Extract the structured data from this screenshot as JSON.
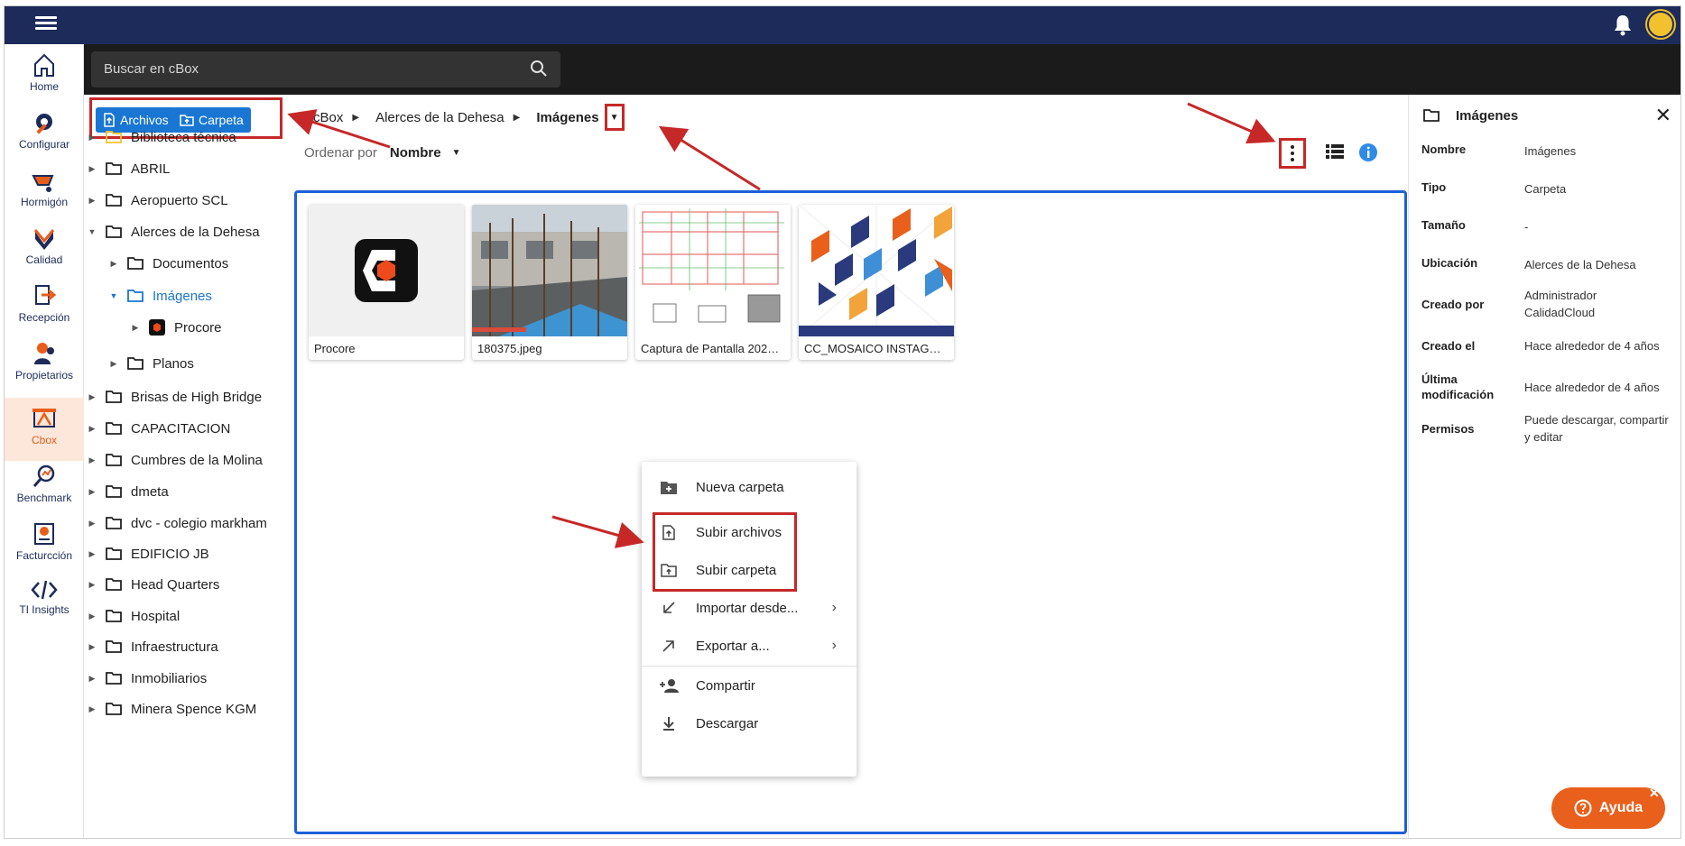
{
  "search": {
    "placeholder": "Buscar en cBox"
  },
  "rail": [
    {
      "label": "Home"
    },
    {
      "label": "Configurar"
    },
    {
      "label": "Hormigón"
    },
    {
      "label": "Calidad"
    },
    {
      "label": "Recepción"
    },
    {
      "label": "Propietarios"
    },
    {
      "label": "Cbox"
    },
    {
      "label": "Benchmark"
    },
    {
      "label": "Facturcción"
    },
    {
      "label": "TI Insights"
    }
  ],
  "upload": {
    "files_label": "Archivos",
    "folder_label": "Carpeta"
  },
  "tree": [
    {
      "label": "Biblioteca técnica"
    },
    {
      "label": "ABRIL"
    },
    {
      "label": "Aeropuerto SCL"
    },
    {
      "label": "Alerces de la Dehesa"
    },
    {
      "label": "Documentos"
    },
    {
      "label": "Imágenes"
    },
    {
      "label": "Procore"
    },
    {
      "label": "Planos"
    },
    {
      "label": "Brisas de High Bridge"
    },
    {
      "label": "CAPACITACION"
    },
    {
      "label": "Cumbres de la Molina"
    },
    {
      "label": "dmeta"
    },
    {
      "label": "dvc - colegio markham"
    },
    {
      "label": "EDIFICIO JB"
    },
    {
      "label": "Head Quarters"
    },
    {
      "label": "Hospital"
    },
    {
      "label": "Infraestructura"
    },
    {
      "label": "Inmobiliarios"
    },
    {
      "label": "Minera Spence KGM"
    }
  ],
  "breadcrumb": {
    "root": "cBox",
    "parent": "Alerces de la Dehesa",
    "current": "Imágenes"
  },
  "sort": {
    "label": "Ordenar por",
    "value": "Nombre"
  },
  "files": [
    {
      "name": "Procore"
    },
    {
      "name": "180375.jpeg"
    },
    {
      "name": "Captura de Pantalla 2022-0..."
    },
    {
      "name": "CC_MOSAICO INSTAGRAM L..."
    }
  ],
  "context_menu": {
    "new_folder": "Nueva carpeta",
    "upload_files": "Subir archivos",
    "upload_folder": "Subir carpeta",
    "import_from": "Importar desde...",
    "export_to": "Exportar a...",
    "share": "Compartir",
    "download": "Descargar"
  },
  "detail": {
    "title": "Imágenes",
    "rows": [
      {
        "key": "Nombre",
        "value": "Imágenes"
      },
      {
        "key": "Tipo",
        "value": "Carpeta"
      },
      {
        "key": "Tamaño",
        "value": "-"
      },
      {
        "key": "Ubicación",
        "value": "Alerces de la Dehesa"
      },
      {
        "key": "Creado por",
        "value": "Administrador CalidadCloud"
      },
      {
        "key": "Creado el",
        "value": "Hace alrededor de 4 años"
      },
      {
        "key": "Última modificación",
        "value": "Hace alrededor de 4 años"
      },
      {
        "key": "Permisos",
        "value": "Puede descargar, compartir y editar"
      }
    ]
  },
  "help": {
    "label": "Ayuda"
  },
  "colors": {
    "navy": "#1c2b5a",
    "accent_orange": "#e8601c",
    "primary_blue": "#1976d2",
    "annotation_red": "#c62828"
  }
}
